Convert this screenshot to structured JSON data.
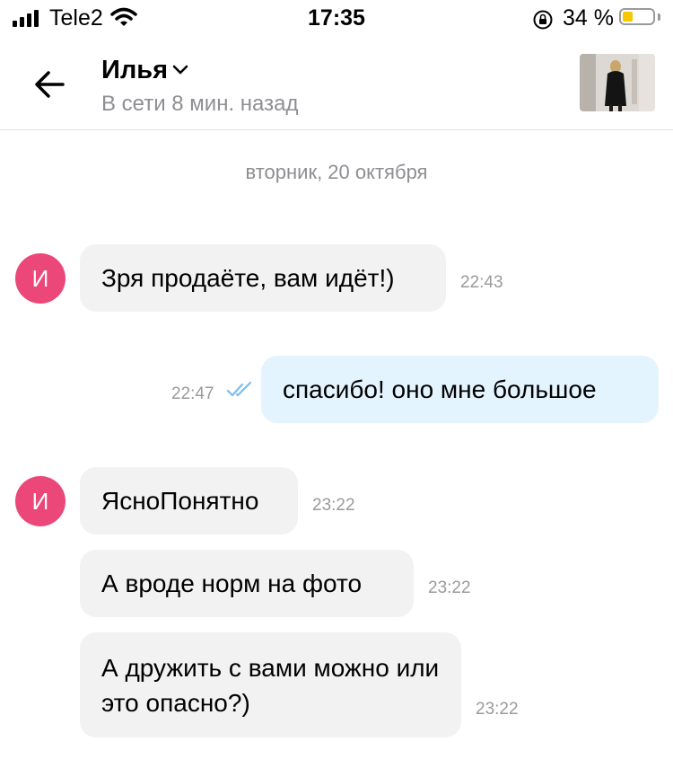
{
  "status_bar": {
    "carrier": "Tele2",
    "time": "17:35",
    "battery_percent": "34 %",
    "battery_level": 0.34,
    "battery_color": "#f7c800",
    "icons": [
      "signal-icon",
      "wifi-icon",
      "rotation-lock-icon",
      "battery-icon"
    ]
  },
  "header": {
    "contact_name": "Илья",
    "presence": "В сети 8 мин. назад",
    "icons": [
      "back-arrow-icon",
      "chevron-down-icon"
    ]
  },
  "conversation": {
    "date_separator": "вторник, 20 октября",
    "avatar_letter": "И",
    "avatar_color": "#ec4779",
    "messages": [
      {
        "direction": "incoming",
        "text": "Зря продаёте, вам идёт!)",
        "time": "22:43"
      },
      {
        "direction": "outgoing",
        "text": "спасибо! оно мне большое",
        "time": "22:47",
        "read": true
      },
      {
        "direction": "incoming",
        "text": "ЯсноПонятно",
        "time": "23:22"
      },
      {
        "direction": "incoming",
        "text": "А вроде норм на фото",
        "time": "23:22"
      },
      {
        "direction": "incoming",
        "text": "А дружить с вами можно или это опасно?)",
        "time": "23:22"
      }
    ]
  }
}
